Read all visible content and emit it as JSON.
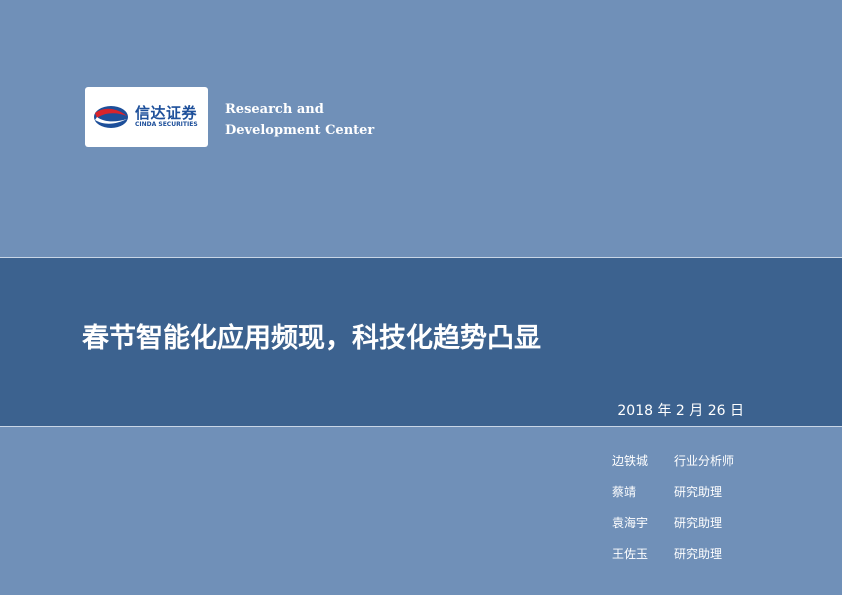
{
  "logo": {
    "name_cn": "信达证券",
    "name_en": "CINDA SECURITIES",
    "icon": "cinda-logo-icon",
    "colors": {
      "red": "#d8242c",
      "blue": "#1d4f9a"
    }
  },
  "org": {
    "line1": "Research and",
    "line2": "Development Center"
  },
  "report": {
    "title": "春节智能化应用频现，科技化趋势凸显",
    "date": "2018 年 2 月 26 日"
  },
  "authors": [
    {
      "name": "边铁城",
      "role": "行业分析师"
    },
    {
      "name": "蔡靖",
      "role": "研究助理"
    },
    {
      "name": "袁海宇",
      "role": "研究助理"
    },
    {
      "name": "王佐玉",
      "role": "研究助理"
    }
  ],
  "colors": {
    "background": "#7090b8",
    "band": "#3c628f",
    "text": "#ffffff"
  }
}
